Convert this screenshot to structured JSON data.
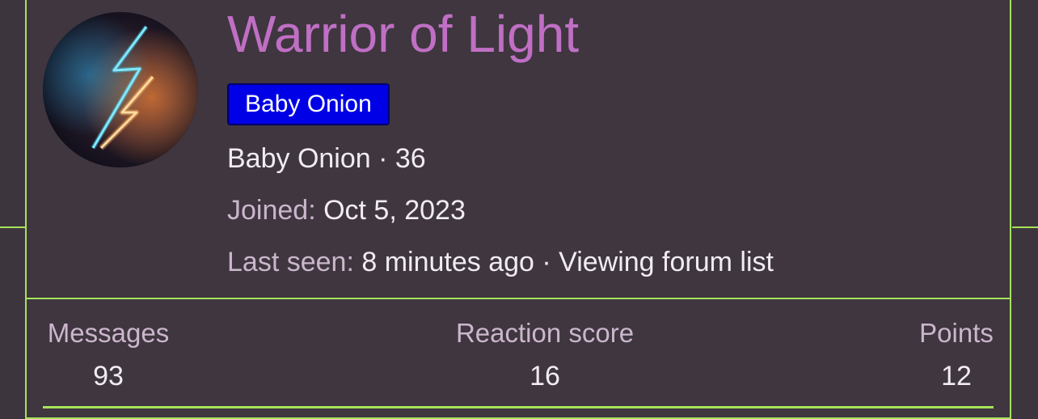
{
  "profile": {
    "username": "Warrior of Light",
    "badge": "Baby Onion",
    "title_line": "Baby Onion · 36",
    "joined_label": "Joined:",
    "joined_value": "Oct 5, 2023",
    "last_seen_label": "Last seen:",
    "last_seen_value": "8 minutes ago · Viewing forum list"
  },
  "stats": [
    {
      "label": "Messages",
      "value": "93"
    },
    {
      "label": "Reaction score",
      "value": "16"
    },
    {
      "label": "Points",
      "value": "12"
    }
  ],
  "colors": {
    "accent_border": "#a6e35a",
    "username": "#c06fc4",
    "badge_bg": "#0000e6",
    "background": "#3f3640"
  },
  "avatar": {
    "icon": "neon-lightning-bolt-icon"
  }
}
